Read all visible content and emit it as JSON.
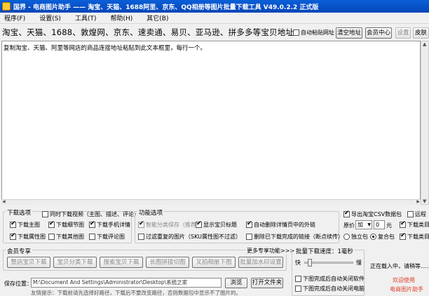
{
  "window": {
    "title": "国界 - 电商图片助手 —— 淘宝、天猫、1688阿里、京东、QQ相册等图片批量下载工具 V49.0.2.2 正式版"
  },
  "menu": [
    "程序(F)",
    "设置(S)",
    "工具(T)",
    "帮助(H)",
    "其它(B)"
  ],
  "sites_line": "淘宝、天猫、1688、敦煌网、京东、速卖通、易贝、亚马逊、拼多多等宝贝地址:",
  "auto_paste_label": "自动粘贴网址",
  "buttons": {
    "clear": "清空地址",
    "member": "会员中心",
    "settings": "设置",
    "skin": "皮肤"
  },
  "url_placeholder": "复制淘宝、天猫、阿里等网店的商品连接地址粘贴到此文本框里，每行一个。",
  "download_options": {
    "title": "下载选项",
    "items": [
      {
        "label": "同时下载视频（主图、描述、评论）",
        "checked": false
      },
      {
        "label": "下载主图",
        "checked": true
      },
      {
        "label": "下载细节图",
        "checked": true
      },
      {
        "label": "下载手机详情",
        "checked": true
      },
      {
        "label": "下载属性图",
        "checked": true
      },
      {
        "label": "下载其他图",
        "checked": false
      },
      {
        "label": "下载评论图",
        "checked": false
      }
    ]
  },
  "function_options": {
    "title": "功能选项",
    "items": [
      {
        "label": "智能分类保存（推荐）",
        "checked": true
      },
      {
        "label": "显示宝贝标题",
        "checked": true
      },
      {
        "label": "自动删除详情页中的外链",
        "checked": true
      },
      {
        "label": "过滤重复的图片（SKU属性图不过滤）",
        "checked": false
      },
      {
        "label": "删除已下载完成的链接（断点续传）",
        "checked": false
      }
    ]
  },
  "right_options": {
    "export_csv": "导出淘宝CSV数据包",
    "export_csv_checked": true,
    "remote": "远程",
    "price_label": "原价",
    "price_op": "加",
    "price_value": "0",
    "price_unit": "元",
    "download_sku": "下载类目",
    "radio_independent": "独立包",
    "radio_combined": "复合包"
  },
  "member_zone": {
    "title": "会员专享",
    "more": "更多专享功能>>>",
    "buttons": [
      "整店宝贝下载",
      "宝贝分类下载",
      "搜索宝贝下载",
      "长图拼接切图",
      "叉拍相册下图",
      "批量加水印设置"
    ]
  },
  "speed": {
    "title": "批量下载速度：1毫秒",
    "fast": "快",
    "slow": "慢",
    "level": 0.08,
    "after_done_close_software": "下图完成后自动关闭软件",
    "after_done_shutdown": "下图完成后自动关闭电脑"
  },
  "status": {
    "loading": "正在载入中，请稍等……",
    "welcome": "欢迎使用",
    "app_name": "电商图片助手"
  },
  "save": {
    "label": "保存位置：",
    "path": "M:\\Document And Settings\\Administrator\\Desktop\\系统之家",
    "browse": "浏览",
    "open_folder": "打开文件夹",
    "tip": "友情提示：下载前请先选择好路径，下载后不要改变路径，否则数据包中显示不了图片的。"
  }
}
